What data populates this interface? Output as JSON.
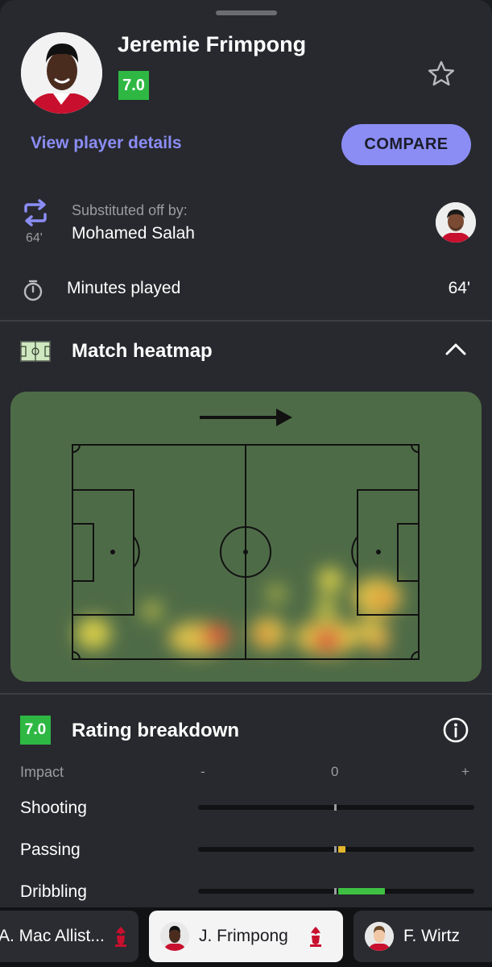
{
  "player": {
    "name": "Jeremie Frimpong",
    "rating": "7.0",
    "details_link": "View player details",
    "compare_label": "COMPARE",
    "club_badge_text": "LFC"
  },
  "substitution": {
    "minute": "64'",
    "label": "Substituted off by:",
    "player": "Mohamed Salah"
  },
  "minutes": {
    "label": "Minutes played",
    "value": "64'"
  },
  "heatmap": {
    "title": "Match heatmap",
    "attack_direction": "right"
  },
  "rating_breakdown": {
    "title": "Rating breakdown",
    "rating": "7.0",
    "impact_label": "Impact",
    "axis_min": "-",
    "axis_zero": "0",
    "axis_max": "+",
    "rows": [
      {
        "label": "Shooting",
        "impact": 0.0,
        "color": "#9a9ca2"
      },
      {
        "label": "Passing",
        "impact": 0.05,
        "color": "#e3b52c"
      },
      {
        "label": "Dribbling",
        "impact": 0.34,
        "color": "#3ec142"
      }
    ]
  },
  "bottom_tabs": [
    {
      "label": "A. Mac Allist...",
      "active": false
    },
    {
      "label": "J. Frimpong",
      "active": true
    },
    {
      "label": "F. Wirtz",
      "active": false
    }
  ],
  "colors": {
    "accent": "#8b8df5",
    "rating_green": "#2eb843",
    "background": "#27292e",
    "pitch": "#4e6b47"
  },
  "icons": [
    "star-icon",
    "substitution-icon",
    "stopwatch-icon",
    "pitch-icon",
    "chevron-up-icon",
    "info-icon",
    "lfc-crest-icon"
  ]
}
